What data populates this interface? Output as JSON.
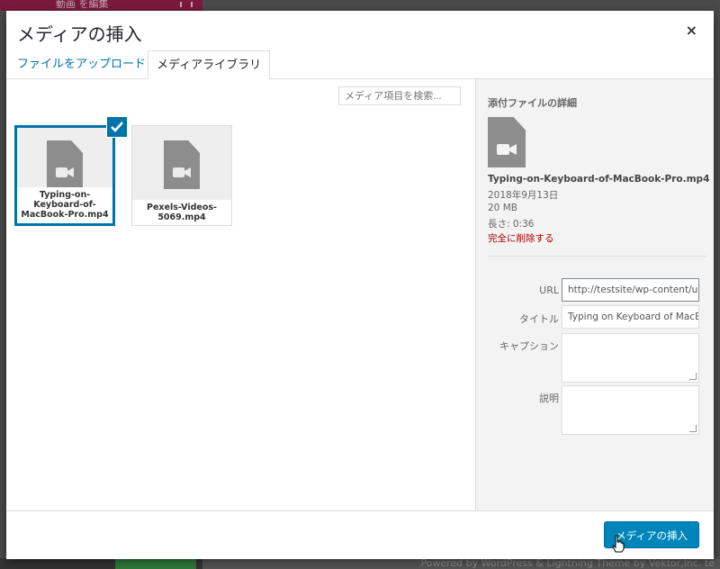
{
  "background": {
    "top_tab": "動画 を編集",
    "footer": "Powered by WordPress & Lightning Theme by Vektor,Inc. te"
  },
  "modal": {
    "title": "メディアの挿入",
    "close": "×",
    "tabs": {
      "upload": "ファイルをアップロード",
      "library": "メディアライブラリ"
    },
    "search_placeholder": "メディア項目を検索..."
  },
  "attachments": [
    {
      "name": "Typing-on-Keyboard-of-MacBook-Pro.mp4",
      "selected": true,
      "icon": "video-file-icon"
    },
    {
      "name": "Pexels-Videos-5069.mp4",
      "selected": false,
      "icon": "video-file-icon"
    }
  ],
  "details": {
    "heading": "添付ファイルの詳細",
    "filename": "Typing-on-Keyboard-of-MacBook-Pro.mp4",
    "date": "2018年9月13日",
    "size": "20 MB",
    "length": "長さ: 0:36",
    "delete": "完全に削除する",
    "fields": {
      "url_label": "URL",
      "url_value": "http://testsite/wp-content/up",
      "title_label": "タイトル",
      "title_value": "Typing on Keyboard of MacBo",
      "caption_label": "キャプション",
      "caption_value": "",
      "description_label": "説明",
      "description_value": ""
    }
  },
  "toolbar": {
    "insert_label": "メディアの挿入"
  },
  "colors": {
    "accent": "#0073aa",
    "button": "#0085ba",
    "danger": "#a00"
  }
}
